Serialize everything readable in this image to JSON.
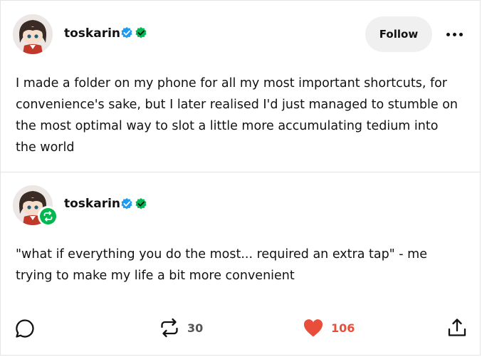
{
  "post": {
    "author": "toskarin",
    "follow_label": "Follow",
    "more_label": "More options",
    "text": "I made a folder on my phone for all my most important shortcuts, for convenience's sake, but I later realised I'd just managed to stumble on the most optimal way to slot a little more accumulating tedium into the world"
  },
  "reblog": {
    "author": "toskarin",
    "text": "\"what if everything you do the most... required an extra tap\" - me trying to make my life a bit more convenient"
  },
  "actions": {
    "reblog_count": "30",
    "like_count": "106"
  },
  "icons": {
    "verified": "verified-check-icon",
    "green_badge": "green-check-icon",
    "reply": "reply-bubble-icon",
    "reblog": "reblog-icon",
    "like": "heart-icon",
    "share": "share-icon",
    "more": "more-dots-icon"
  },
  "colors": {
    "verified_blue": "#1d9bf0",
    "badge_green": "#00b84f",
    "like_red": "#e94e3a",
    "follow_bg": "#f0f0f0"
  }
}
